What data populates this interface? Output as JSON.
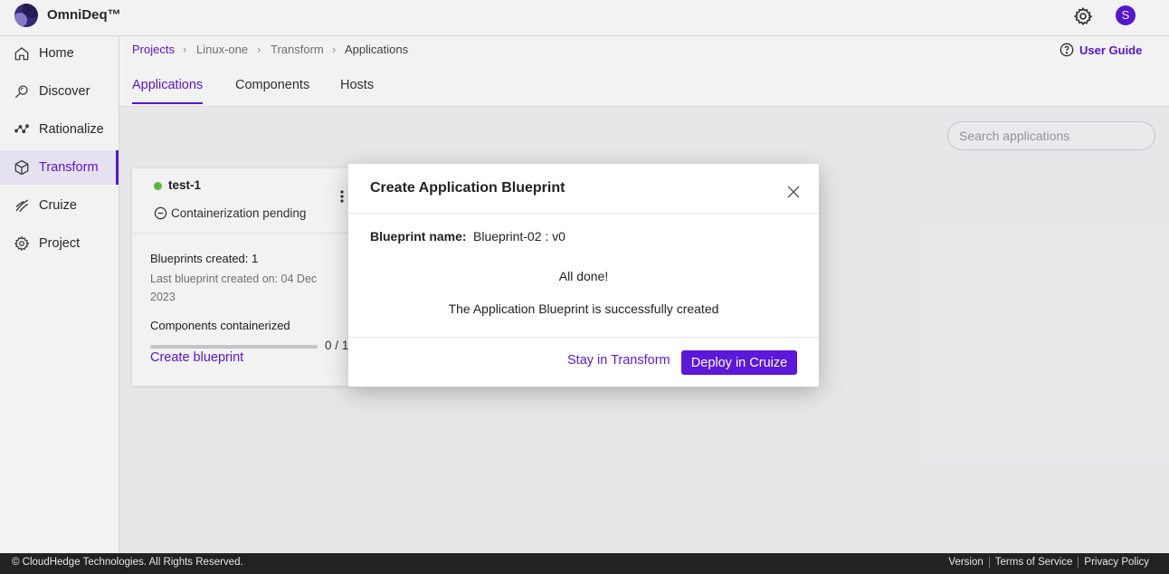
{
  "app": {
    "brand": "OmniDeq™",
    "avatar_initial": "S",
    "accent": "#5b18d9"
  },
  "sidebar": {
    "items": [
      {
        "label": "Home",
        "icon": "home-icon"
      },
      {
        "label": "Discover",
        "icon": "discover-icon"
      },
      {
        "label": "Rationalize",
        "icon": "rationalize-icon"
      },
      {
        "label": "Transform",
        "icon": "cube-icon",
        "active": true
      },
      {
        "label": "Cruize",
        "icon": "cruize-icon"
      },
      {
        "label": "Project",
        "icon": "gear-icon"
      }
    ]
  },
  "breadcrumb": {
    "items": [
      "Projects",
      "Linux-one",
      "Transform",
      "Applications"
    ],
    "separator": "›"
  },
  "user_guide": "User Guide",
  "tabs": [
    "Applications",
    "Components",
    "Hosts"
  ],
  "search": {
    "placeholder": "Search applications",
    "value": ""
  },
  "card": {
    "title": "test-1",
    "status": "Containerization pending",
    "blueprints_created": "Blueprints created: 1",
    "last_blueprint": "Last blueprint created on: 04 Dec 2023",
    "components_label": "Components containerized",
    "progress_text": "0 / 1",
    "progress_fraction": 0,
    "create_blueprint": "Create blueprint"
  },
  "modal": {
    "title": "Create Application Blueprint",
    "name_label": "Blueprint name:",
    "name_value": "Blueprint-02 : v0",
    "done": "All done!",
    "success": "The Application Blueprint is successfully created",
    "stay_label": "Stay in Transform",
    "deploy_label": "Deploy in Cruize"
  },
  "footer": {
    "copyright": "© CloudHedge Technologies. All Rights Reserved.",
    "links": [
      "Version",
      "Terms of Service",
      "Privacy Policy"
    ]
  }
}
